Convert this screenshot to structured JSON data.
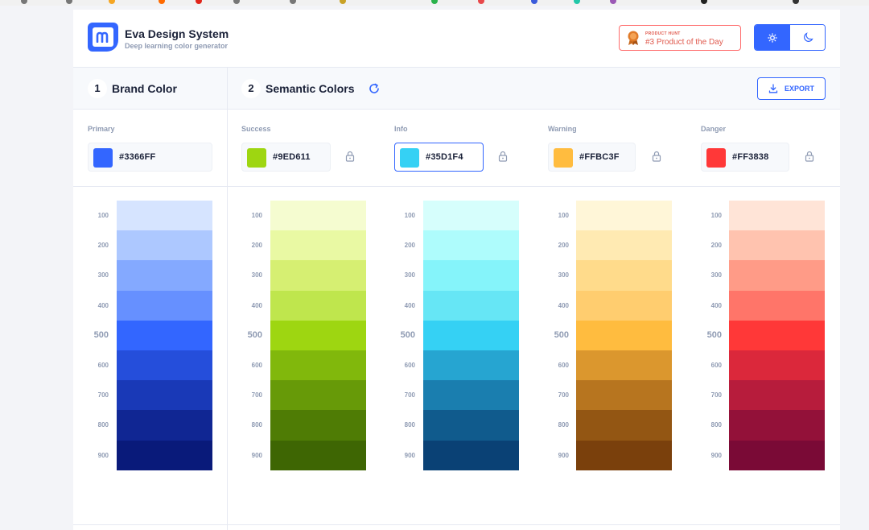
{
  "header": {
    "title": "Eva Design System",
    "subtitle": "Deep learning color generator",
    "badge": {
      "small": "PRODUCT HUNT",
      "main": "#3 Product of the Day"
    }
  },
  "sections": {
    "brand": {
      "num": "1",
      "label": "Brand Color"
    },
    "semantic": {
      "num": "2",
      "label": "Semantic Colors"
    },
    "export_label": "EXPORT"
  },
  "colors": {
    "primary": {
      "label": "Primary",
      "hex": "#3366FF",
      "swatch": "#3366FF",
      "shades": [
        "#D6E4FF",
        "#ADC8FF",
        "#84A9FF",
        "#6690FF",
        "#3366FF",
        "#254EDB",
        "#1939B7",
        "#102693",
        "#091A7A"
      ]
    },
    "success": {
      "label": "Success",
      "hex": "#9ED611",
      "swatch": "#9ED611",
      "shades": [
        "#F5FCD0",
        "#E9F9A3",
        "#D6EF72",
        "#BFE64D",
        "#9ED611",
        "#81B80C",
        "#679A08",
        "#4F7C05",
        "#3E6603"
      ]
    },
    "info": {
      "label": "Info",
      "hex": "#35D1F4",
      "swatch": "#35D1F4",
      "shades": [
        "#D6FEFC",
        "#AEFCFC",
        "#85F4FA",
        "#66E6F5",
        "#35D1F4",
        "#26A5D1",
        "#1A7EAF",
        "#105B8D",
        "#0A4175"
      ]
    },
    "warning": {
      "label": "Warning",
      "hex": "#FFBC3F",
      "swatch": "#FFBC3F",
      "shades": [
        "#FFF6D8",
        "#FFEAB2",
        "#FFDB8B",
        "#FFCD6F",
        "#FFBC3F",
        "#DB972E",
        "#B7751F",
        "#935613",
        "#7A400C"
      ]
    },
    "danger": {
      "label": "Danger",
      "hex": "#FF3838",
      "swatch": "#FF3838",
      "shades": [
        "#FFE4D7",
        "#FFC3AF",
        "#FF9B87",
        "#FF7569",
        "#FF3838",
        "#DB283B",
        "#B71C3C",
        "#931139",
        "#7A0A36"
      ]
    }
  },
  "shade_labels": [
    "100",
    "200",
    "300",
    "400",
    "500",
    "600",
    "700",
    "800",
    "900"
  ],
  "icons": {
    "logo": "eva-logo-icon",
    "badge": "medal-icon",
    "light": "sun-icon",
    "dark": "moon-icon",
    "refresh": "refresh-icon",
    "export": "download-icon",
    "lock": "lock-icon"
  }
}
